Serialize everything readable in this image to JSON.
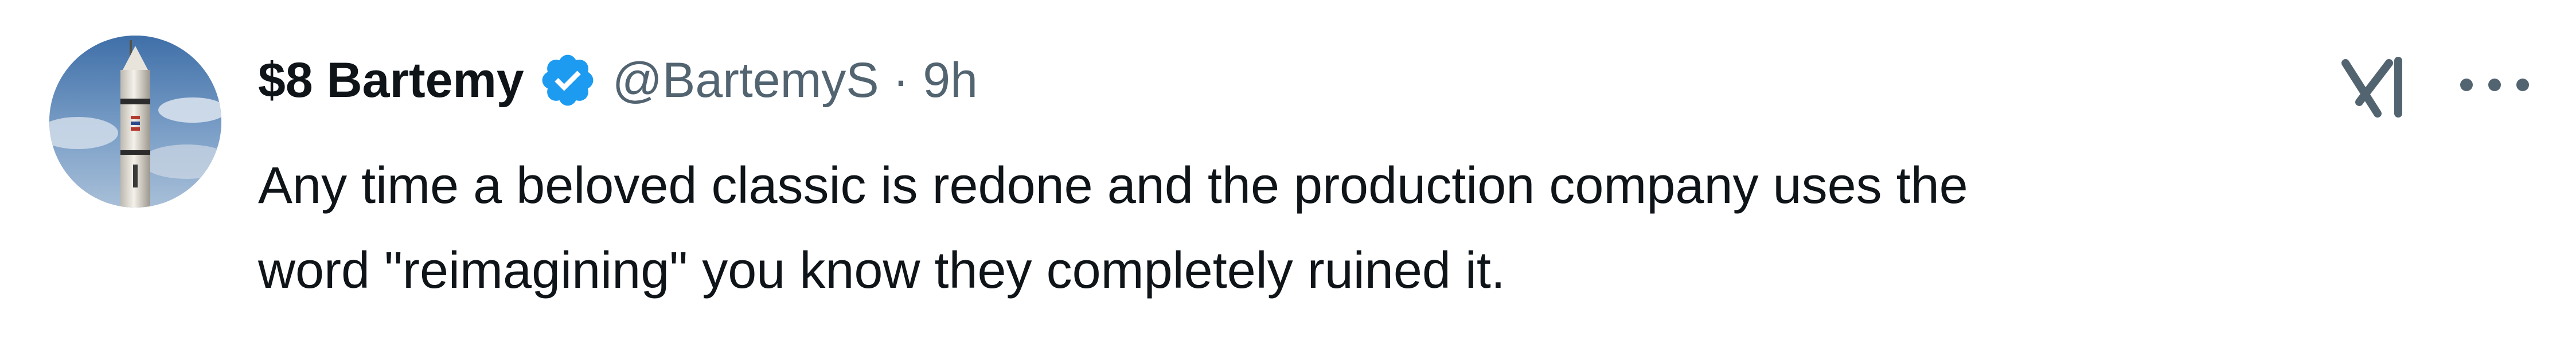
{
  "tweet": {
    "display_name": "$8 Bartemy",
    "handle": "@BartemyS",
    "separator": "·",
    "timestamp": "9h",
    "text": "Any time a beloved classic is redone and the production company uses the\nword \"reimagining\" you know they completely ruined it."
  },
  "icons": {
    "verified": "verified-badge-icon",
    "grok": "grok-icon",
    "more": "more-options-icon"
  },
  "colors": {
    "text_primary": "#0f1419",
    "text_secondary": "#536471",
    "verified_blue": "#1d9bf0"
  }
}
